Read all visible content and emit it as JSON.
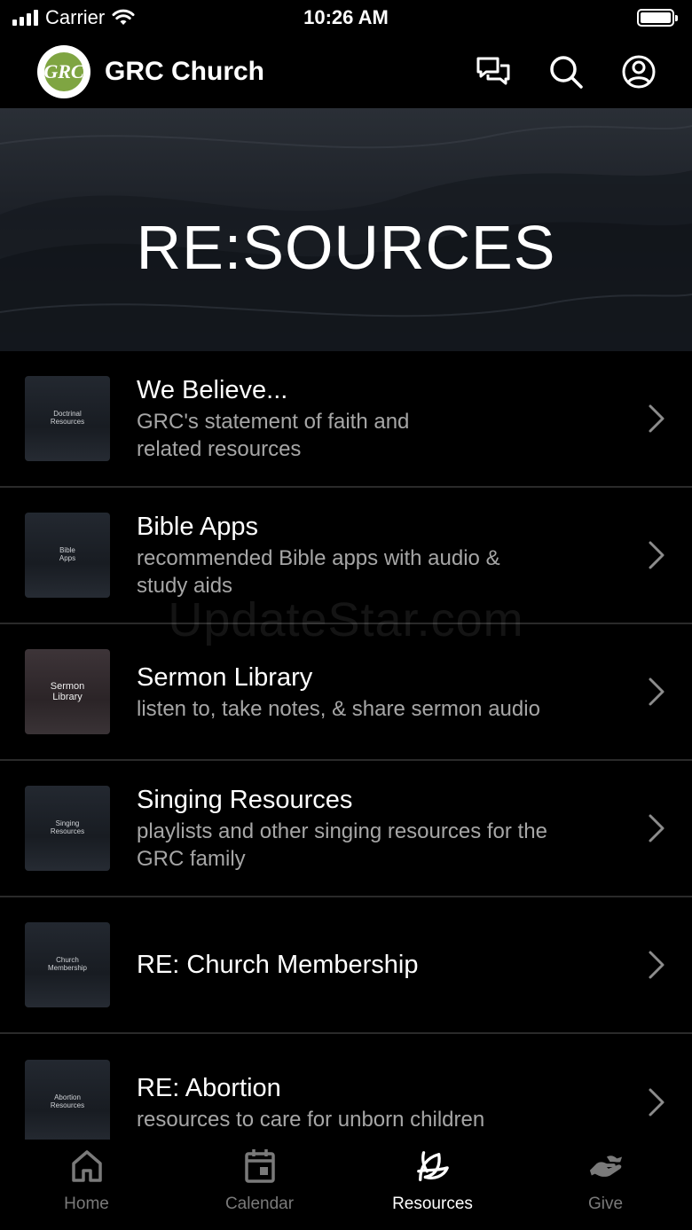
{
  "status_bar": {
    "carrier": "Carrier",
    "time": "10:26 AM"
  },
  "header": {
    "title": "GRC Church",
    "logo_text": "GRC"
  },
  "banner": {
    "title": "RE:SOURCES"
  },
  "watermark": "UpdateStar.com",
  "list": [
    {
      "thumb": "Doctrinal\nResources",
      "title": "We Believe...",
      "subtitle": "GRC's statement of faith and\nrelated resources"
    },
    {
      "thumb": "Bible\nApps",
      "title": "Bible Apps",
      "subtitle": "recommended Bible apps with audio &\nstudy aids"
    },
    {
      "thumb": "Sermon\nLibrary",
      "title": "Sermon Library",
      "subtitle": "listen to, take notes, & share sermon audio"
    },
    {
      "thumb": "Singing\nResources",
      "title": "Singing Resources",
      "subtitle": "playlists and other singing resources for the\nGRC family"
    },
    {
      "thumb": "Church\nMembership",
      "title": "RE: Church Membership",
      "subtitle": ""
    },
    {
      "thumb": "Abortion\nResources",
      "title": "RE: Abortion",
      "subtitle": "resources to care for unborn children"
    }
  ],
  "tabs": [
    {
      "label": "Home",
      "icon": "home-icon"
    },
    {
      "label": "Calendar",
      "icon": "calendar-icon"
    },
    {
      "label": "Resources",
      "icon": "leaf-icon"
    },
    {
      "label": "Give",
      "icon": "give-hand-icon"
    }
  ],
  "colors": {
    "logo_green": "#7fa542",
    "active_tab": "#ffffff",
    "inactive_tab": "#7a7a7a",
    "subtitle": "#a6a6a6"
  }
}
